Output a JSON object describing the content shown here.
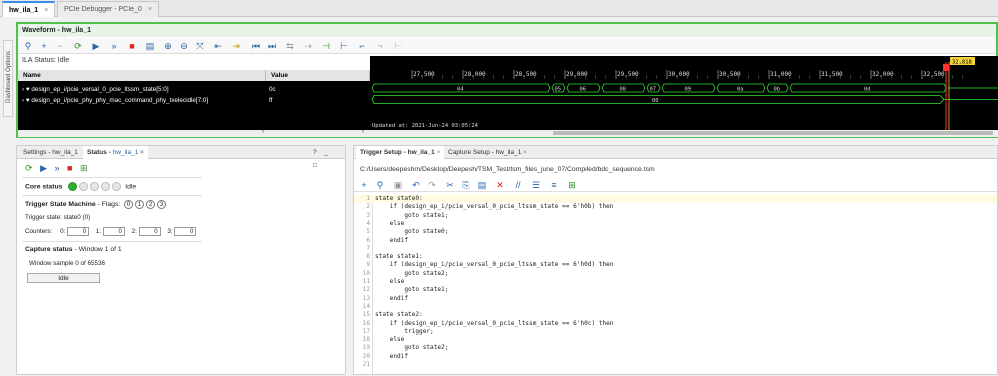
{
  "top_tabs": [
    {
      "label": "hw_ila_1",
      "active": true
    },
    {
      "label": "PCIe Debugger - PCIe_0",
      "active": false
    }
  ],
  "dashboard_options": "Dashboard Options",
  "waveform": {
    "title": "Waveform - hw_ila_1",
    "ila_status": "ILA Status: Idle",
    "name_header": "Name",
    "value_header": "Value",
    "signals": [
      {
        "name": "design_ep_i/pcie_versal_0_pcie_ltssm_state[5:0]",
        "value": "0c"
      },
      {
        "name": "design_ep_i/pcie_phy_phy_mac_command_phy_txelecidle[7:0]",
        "value": "ff"
      }
    ],
    "cursor_value": "32,818",
    "time_ticks": [
      "27,500",
      "28,000",
      "28,500",
      "29,000",
      "29,500",
      "30,000",
      "30,500",
      "31,000",
      "31,500",
      "32,000",
      "32,500"
    ],
    "updated": "Updated at: 2021-Jun-24 03:05:24",
    "row1_segments": [
      "04",
      "05",
      "06",
      "08",
      "07",
      "09",
      "0a",
      "0b",
      "0d"
    ],
    "row2_value": "00",
    "accent_green": "#4fc34f"
  },
  "left_panel": {
    "tabs": [
      {
        "label": "Settings - hw_ila_1",
        "active": false
      },
      {
        "label": "Status - ",
        "suffix": "hw_ila_1",
        "active": true
      }
    ],
    "controls": "? _ □",
    "core_status_label": "Core status",
    "core_status_value": "Idle",
    "trigger_sm_label": "Trigger State Machine",
    "flags_label": "- Flags:",
    "flags": [
      "0",
      "1",
      "2",
      "3"
    ],
    "trigger_state": "Trigger state:  state0 (0)",
    "counters_label": "Counters:",
    "counters": [
      {
        "label": "0:",
        "value": "0"
      },
      {
        "label": "1:",
        "value": "0"
      },
      {
        "label": "2:",
        "value": "0"
      },
      {
        "label": "3:",
        "value": "0"
      }
    ],
    "capture_status_label": "Capture status",
    "capture_window": "-   Window 1 of 1",
    "window_sample": "Window sample 0 of 65536",
    "idle_button": "Idle"
  },
  "right_panel": {
    "tabs": [
      {
        "label": "Trigger Setup - hw_ila_1",
        "active": true
      },
      {
        "label": "Capture Setup - hw_ila_1",
        "active": false
      }
    ],
    "path": "C:/Users/deepeshm/Desktop/Deepesh/TSM_Test/tsm_files_june_07/Compiled/bdc_sequence.tsm",
    "code": [
      {
        "n": "1",
        "t": "state state0:"
      },
      {
        "n": "2",
        "t": "    if (design_ep_i/pcie_versal_0_pcie_ltssm_state == 6'h0b) then"
      },
      {
        "n": "3",
        "t": "        goto state1;"
      },
      {
        "n": "4",
        "t": "    else"
      },
      {
        "n": "5",
        "t": "        goto state0;"
      },
      {
        "n": "6",
        "t": "    endif"
      },
      {
        "n": "7",
        "t": ""
      },
      {
        "n": "8",
        "t": "state state1:"
      },
      {
        "n": "9",
        "t": "    if (design_ep_i/pcie_versal_0_pcie_ltssm_state == 6'h0d) then"
      },
      {
        "n": "10",
        "t": "        goto state2;"
      },
      {
        "n": "11",
        "t": "    else"
      },
      {
        "n": "12",
        "t": "        goto state1;"
      },
      {
        "n": "13",
        "t": "    endif"
      },
      {
        "n": "14",
        "t": ""
      },
      {
        "n": "15",
        "t": "state state2:"
      },
      {
        "n": "16",
        "t": "    if (design_ep_i/pcie_versal_0_pcie_ltssm_state == 6'h0c) then"
      },
      {
        "n": "17",
        "t": "        trigger;"
      },
      {
        "n": "18",
        "t": "    else"
      },
      {
        "n": "19",
        "t": "        goto state2;"
      },
      {
        "n": "20",
        "t": "    endif"
      },
      {
        "n": "21",
        "t": ""
      }
    ]
  }
}
